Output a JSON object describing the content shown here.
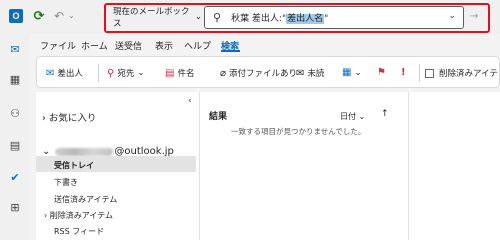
{
  "titlebar": {
    "logo_letter": "O",
    "search_scope": "現在のメールボックス",
    "search_prefix": "秋葉 差出人:\"",
    "search_highlight": "差出人名",
    "search_suffix": "\""
  },
  "tabs": [
    "ファイル",
    "ホーム",
    "送受信",
    "表示",
    "ヘルプ",
    "検索"
  ],
  "ribbon": {
    "from": "差出人",
    "to": "宛先",
    "subject": "件名",
    "attachments": "添付ファイルあり",
    "unread": "未読",
    "include_deleted": "削除済みアイテ"
  },
  "folders": {
    "favorites": "お気に入り",
    "account_suffix": "@outlook.jp",
    "items": [
      "受信トレイ",
      "下書き",
      "送信済みアイテム",
      "削除済みアイテム",
      "RSS フィード"
    ]
  },
  "results": {
    "title": "結果",
    "sort_label": "日付",
    "empty_message": "一致する項目が見つかりませんでした。"
  },
  "colors": {
    "accent": "#0f6cbd",
    "highlight_frame": "#e0101c",
    "flag": "#d13438"
  }
}
